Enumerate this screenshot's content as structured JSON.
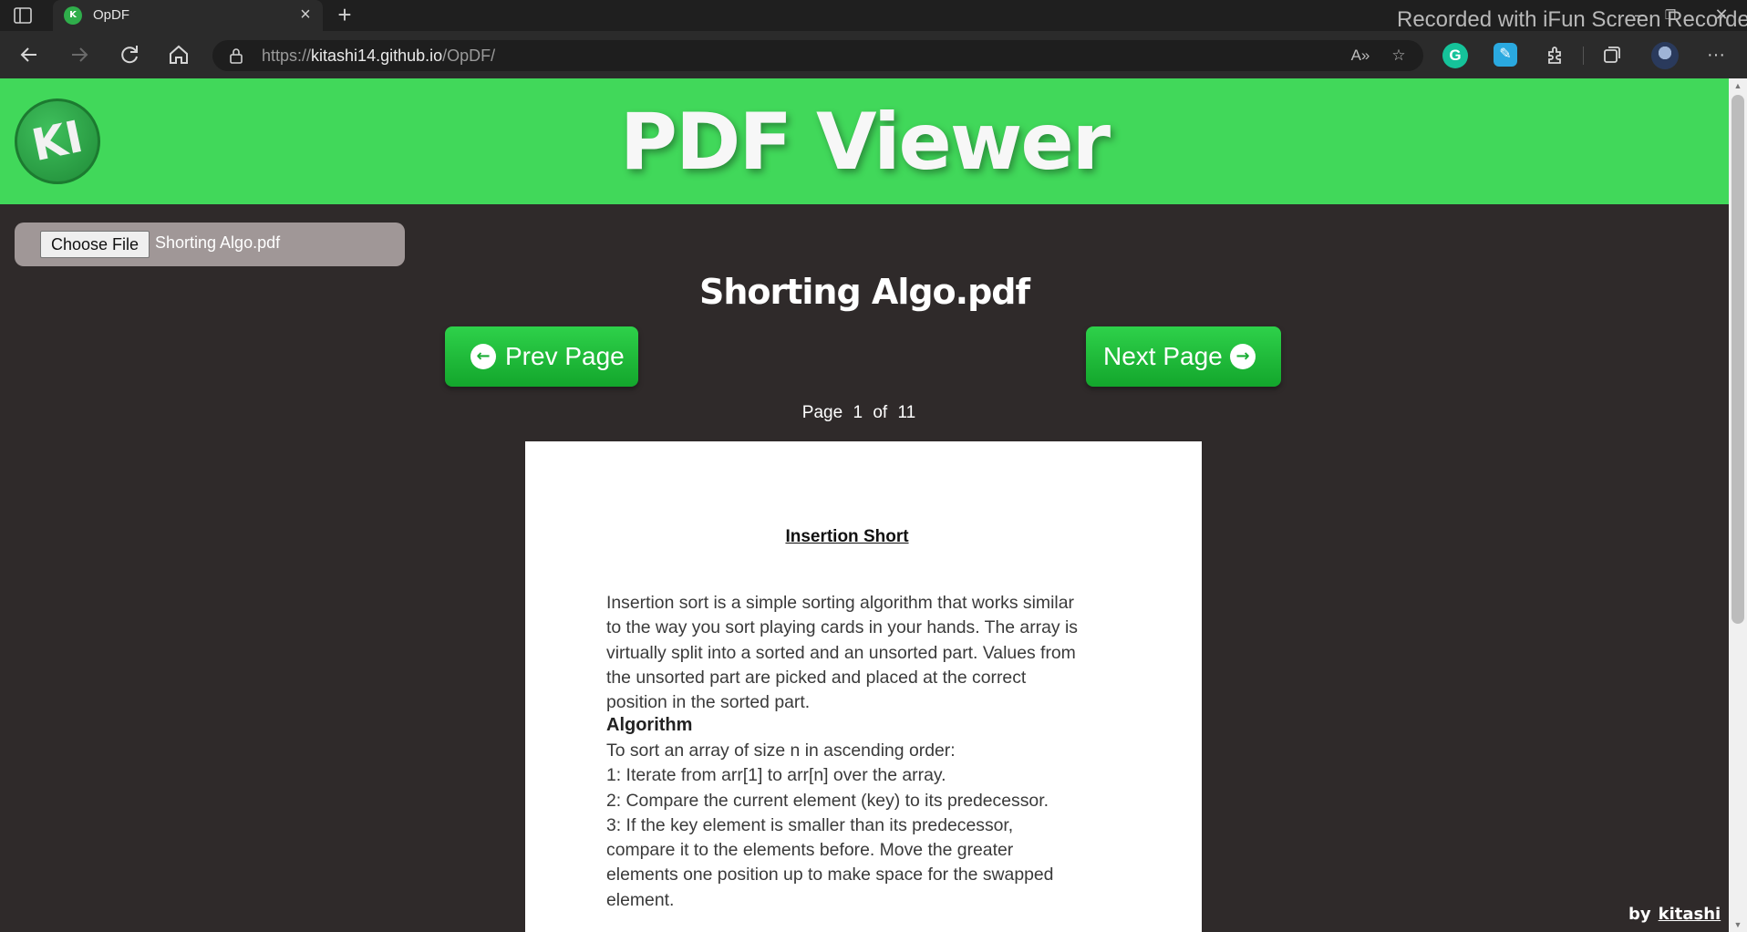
{
  "browser": {
    "tab_title": "OpDF",
    "tab_favicon_text": "K",
    "new_tab_symbol": "+",
    "url_scheme": "https://",
    "url_host": "kitashi14.github.io",
    "url_path": "/OpDF/",
    "watermark": "Recorded with iFun Screen Recorder",
    "icons": [
      "tab-actions-icon",
      "back-icon",
      "forward-icon",
      "refresh-icon",
      "home-icon",
      "lock-icon",
      "read-aloud-icon",
      "add-favorite-icon",
      "grammarly-icon",
      "extension-pen-icon",
      "extensions-icon",
      "collections-icon",
      "profile-avatar",
      "more-icon",
      "minimize-icon",
      "maximize-icon",
      "close-icon"
    ]
  },
  "header": {
    "title": "PDF Viewer",
    "logo_text": "KI"
  },
  "file_input": {
    "button_label": "Choose File",
    "file_name": "Shorting Algo.pdf"
  },
  "viewer": {
    "document_title": "Shorting Algo.pdf",
    "prev_label": "Prev Page",
    "next_label": "Next Page",
    "page_word": "Page",
    "current_page": "1",
    "of_word": "of",
    "total_pages": "11"
  },
  "pdf_page": {
    "heading": "Insertion Short",
    "intro_lines": [
      "Insertion sort is a simple sorting algorithm that works similar",
      "to the way you sort playing cards in your hands. The array is",
      "virtually split into a sorted and an unsorted part. Values from",
      "the unsorted part are picked and placed at the correct",
      "position in the sorted part."
    ],
    "subheading": "Algorithm",
    "step_lines": [
      "To sort an array of size n in ascending order:",
      "1: Iterate from arr[1] to arr[n] over the array.",
      "2: Compare the current element (key) to its predecessor.",
      "3: If the key element is smaller than its predecessor,",
      "compare it to the elements before. Move the greater",
      "elements one position up to make space for the swapped",
      "element."
    ]
  },
  "footer": {
    "by_label": "by",
    "author": "kitashi"
  },
  "colors": {
    "header_green": "#41d85a",
    "button_green": "#1fbf3a",
    "page_background": "#2f2a2a",
    "chrome_dark": "#1f1f1f"
  }
}
